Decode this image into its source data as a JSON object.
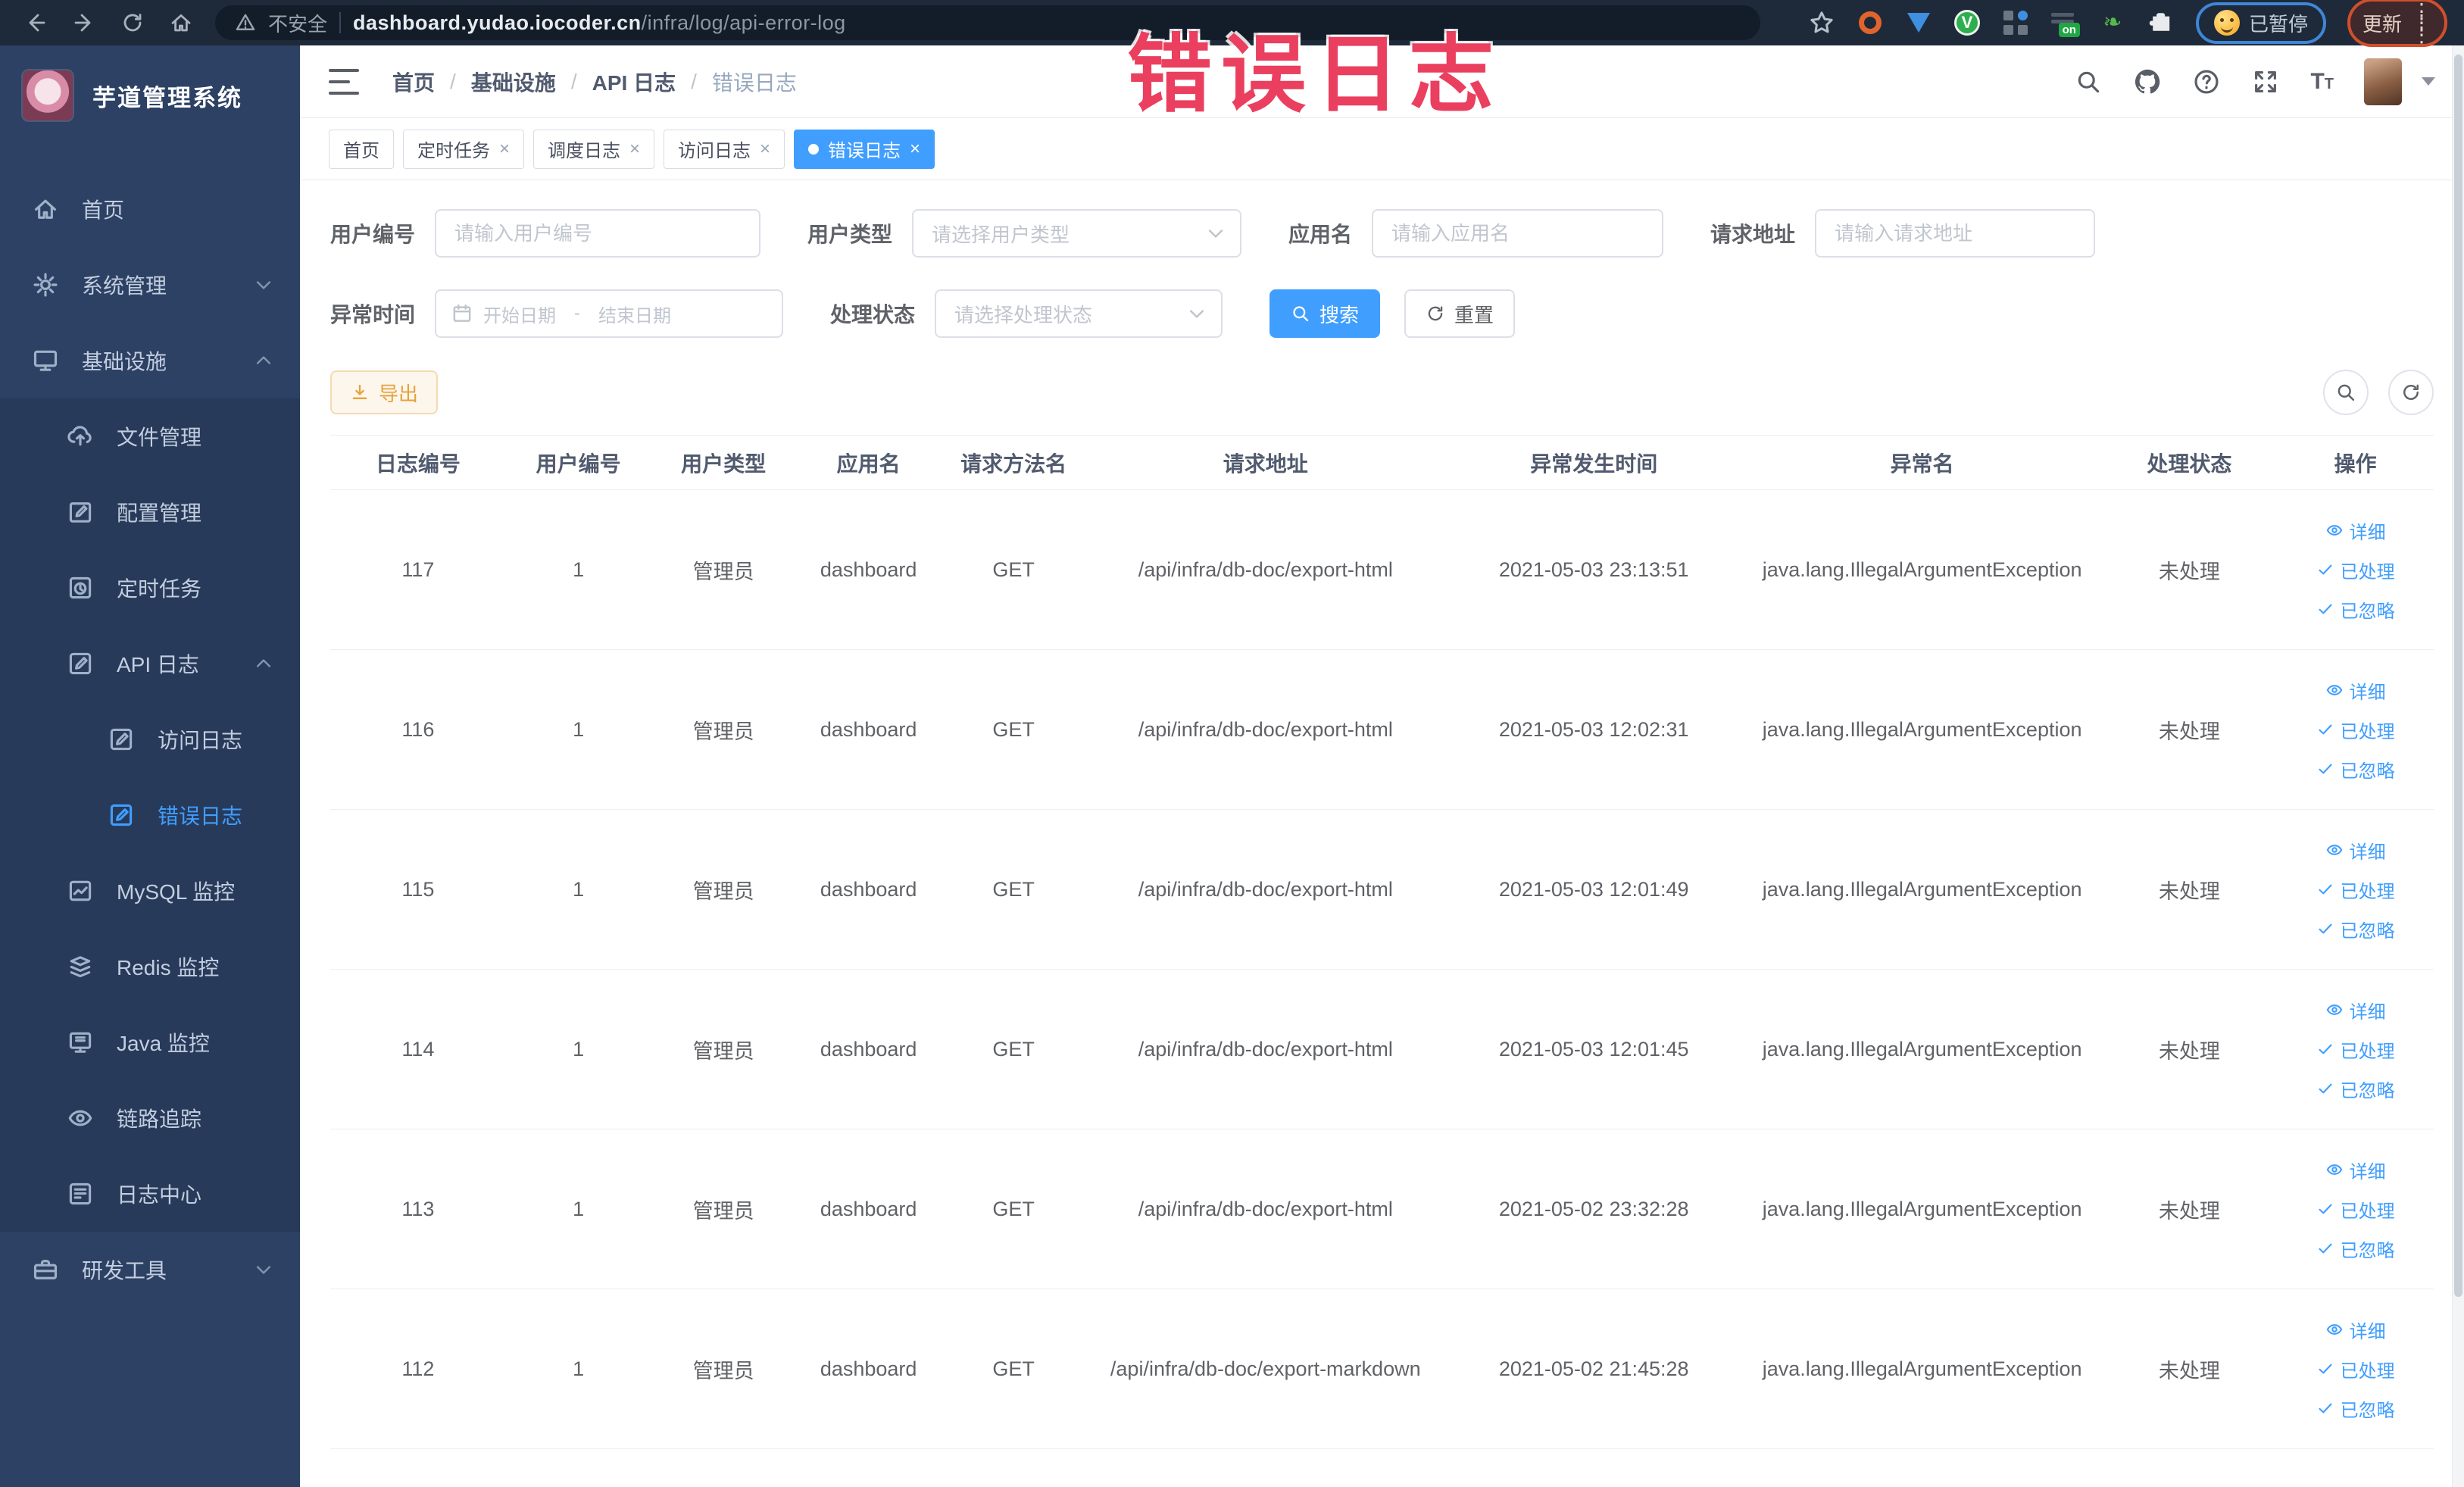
{
  "browser": {
    "security_label": "不安全",
    "url_domain": "dashboard.yudao.iocoder.cn",
    "url_path": "/infra/log/api-error-log",
    "paused_label": "已暂停",
    "update_label": "更新"
  },
  "annotation": {
    "text": "错误日志",
    "color": "#ea3f5e"
  },
  "sidebar": {
    "title": "芋道管理系统",
    "items": [
      {
        "key": "home",
        "label": "首页",
        "icon": "home-icon",
        "level": 1
      },
      {
        "key": "system-mgmt",
        "label": "系统管理",
        "icon": "gear-icon",
        "level": 1,
        "chevron": "down"
      },
      {
        "key": "infrastructure",
        "label": "基础设施",
        "icon": "infra-icon",
        "level": 1,
        "chevron": "up"
      },
      {
        "key": "file-mgmt",
        "label": "文件管理",
        "icon": "cloud-upload-icon",
        "level": 2
      },
      {
        "key": "config-mgmt",
        "label": "配置管理",
        "icon": "edit-icon",
        "level": 2
      },
      {
        "key": "scheduled-jobs",
        "label": "定时任务",
        "icon": "timer-icon",
        "level": 2
      },
      {
        "key": "api-log",
        "label": "API 日志",
        "icon": "api-log-icon",
        "level": 2,
        "chevron": "up"
      },
      {
        "key": "access-log",
        "label": "访问日志",
        "icon": "access-log-icon",
        "level": 3
      },
      {
        "key": "error-log",
        "label": "错误日志",
        "icon": "error-log-icon",
        "level": 3,
        "active": true
      },
      {
        "key": "mysql-monitor",
        "label": "MySQL 监控",
        "icon": "mysql-monitor-icon",
        "level": 2
      },
      {
        "key": "redis-monitor",
        "label": "Redis 监控",
        "icon": "redis-monitor-icon",
        "level": 2
      },
      {
        "key": "java-monitor",
        "label": "Java 监控",
        "icon": "java-monitor-icon",
        "level": 2
      },
      {
        "key": "trace",
        "label": "链路追踪",
        "icon": "trace-icon",
        "level": 2
      },
      {
        "key": "log-center",
        "label": "日志中心",
        "icon": "log-center-icon",
        "level": 2
      },
      {
        "key": "dev-tools",
        "label": "研发工具",
        "icon": "devtools-icon",
        "level": 1,
        "chevron": "down"
      }
    ]
  },
  "breadcrumb": {
    "items": [
      "首页",
      "基础设施",
      "API 日志"
    ],
    "current": "错误日志",
    "separator": "/"
  },
  "tabs": [
    {
      "key": "home",
      "label": "首页",
      "closable": false,
      "active": false
    },
    {
      "key": "job",
      "label": "定时任务",
      "closable": true,
      "active": false
    },
    {
      "key": "job-log",
      "label": "调度日志",
      "closable": true,
      "active": false
    },
    {
      "key": "access-log",
      "label": "访问日志",
      "closable": true,
      "active": false
    },
    {
      "key": "error-log",
      "label": "错误日志",
      "closable": true,
      "active": true
    }
  ],
  "filters": {
    "user_id": {
      "label": "用户编号",
      "placeholder": "请输入用户编号"
    },
    "user_type": {
      "label": "用户类型",
      "placeholder": "请选择用户类型"
    },
    "app_name": {
      "label": "应用名",
      "placeholder": "请输入应用名"
    },
    "request_url": {
      "label": "请求地址",
      "placeholder": "请输入请求地址"
    },
    "exception_time": {
      "label": "异常时间",
      "start_placeholder": "开始日期",
      "separator": "-",
      "end_placeholder": "结束日期"
    },
    "process_status": {
      "label": "处理状态",
      "placeholder": "请选择处理状态"
    },
    "search_label": "搜索",
    "reset_label": "重置"
  },
  "toolbar": {
    "export_label": "导出"
  },
  "table": {
    "columns": [
      "日志编号",
      "用户编号",
      "用户类型",
      "应用名",
      "请求方法名",
      "请求地址",
      "异常发生时间",
      "异常名",
      "处理状态",
      "操作"
    ],
    "actions": {
      "detail": "详细",
      "processed": "已处理",
      "ignored": "已忽略"
    },
    "rows": [
      {
        "id": "117",
        "user_id": "1",
        "user_type": "管理员",
        "app": "dashboard",
        "method": "GET",
        "url": "/api/infra/db-doc/export-html",
        "time": "2021-05-03 23:13:51",
        "exception": "java.lang.IllegalArgumentException",
        "status": "未处理"
      },
      {
        "id": "116",
        "user_id": "1",
        "user_type": "管理员",
        "app": "dashboard",
        "method": "GET",
        "url": "/api/infra/db-doc/export-html",
        "time": "2021-05-03 12:02:31",
        "exception": "java.lang.IllegalArgumentException",
        "status": "未处理"
      },
      {
        "id": "115",
        "user_id": "1",
        "user_type": "管理员",
        "app": "dashboard",
        "method": "GET",
        "url": "/api/infra/db-doc/export-html",
        "time": "2021-05-03 12:01:49",
        "exception": "java.lang.IllegalArgumentException",
        "status": "未处理"
      },
      {
        "id": "114",
        "user_id": "1",
        "user_type": "管理员",
        "app": "dashboard",
        "method": "GET",
        "url": "/api/infra/db-doc/export-html",
        "time": "2021-05-03 12:01:45",
        "exception": "java.lang.IllegalArgumentException",
        "status": "未处理"
      },
      {
        "id": "113",
        "user_id": "1",
        "user_type": "管理员",
        "app": "dashboard",
        "method": "GET",
        "url": "/api/infra/db-doc/export-html",
        "time": "2021-05-02 23:32:28",
        "exception": "java.lang.IllegalArgumentException",
        "status": "未处理"
      },
      {
        "id": "112",
        "user_id": "1",
        "user_type": "管理员",
        "app": "dashboard",
        "method": "GET",
        "url": "/api/infra/db-doc/export-markdown",
        "time": "2021-05-02 21:45:28",
        "exception": "java.lang.IllegalArgumentException",
        "status": "未处理"
      }
    ]
  }
}
